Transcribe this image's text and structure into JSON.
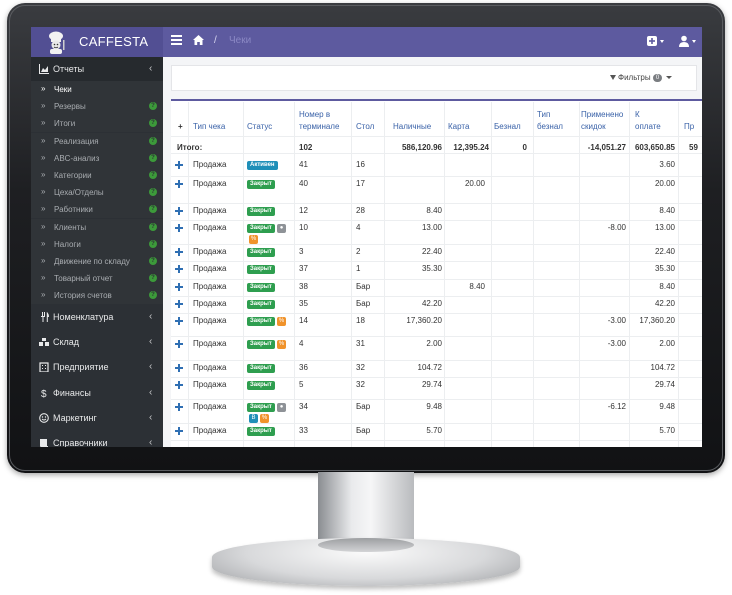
{
  "app": {
    "name": "CAFFESTA"
  },
  "breadcrumb": {
    "separator": "/",
    "current": "Чеки"
  },
  "sidebar": {
    "reports": {
      "label": "Отчеты",
      "chevron": "‹"
    },
    "sub_items": [
      {
        "label": "Чеки",
        "arrow": "»"
      },
      {
        "label": "Резервы",
        "arrow": "»"
      },
      {
        "label": "Итоги",
        "arrow": "»"
      },
      {
        "label": "Реализация",
        "arrow": "»"
      },
      {
        "label": "ABC-анализ",
        "arrow": "»"
      },
      {
        "label": "Категории",
        "arrow": "»"
      },
      {
        "label": "Цеха/Отделы",
        "arrow": "»"
      },
      {
        "label": "Работники",
        "arrow": "»"
      },
      {
        "label": "Клиенты",
        "arrow": "»"
      },
      {
        "label": "Налоги",
        "arrow": "»"
      },
      {
        "label": "Движение по складу",
        "arrow": "»"
      },
      {
        "label": "Товарный отчет",
        "arrow": "»"
      },
      {
        "label": "История счетов",
        "arrow": "»"
      }
    ],
    "help_mark": "?",
    "sections": [
      {
        "label": "Номенклатура",
        "chevron": "‹"
      },
      {
        "label": "Склад",
        "chevron": "‹"
      },
      {
        "label": "Предприятие",
        "chevron": "‹"
      },
      {
        "label": "Финансы",
        "chevron": "‹"
      },
      {
        "label": "Маркетинг",
        "chevron": "‹"
      },
      {
        "label": "Справочники",
        "chevron": "‹"
      }
    ]
  },
  "filters": {
    "label": "Фильтры",
    "count": "0"
  },
  "table": {
    "headers": {
      "plus": "+",
      "type": "Тип чека",
      "status": "Статус",
      "terminal_1": "Номер в",
      "terminal_2": "терминале",
      "table": "Стол",
      "cash": "Наличные",
      "card": "Карта",
      "noncash": "Безнал",
      "noncash_type_1": "Тип",
      "noncash_type_2": "безнал",
      "discount_1": "Применено",
      "discount_2": "скидок",
      "topay_1": "К",
      "topay_2": "оплате",
      "cut": "Пр"
    },
    "totals": {
      "label": "Итого:",
      "terminal": "102",
      "cash": "586,120.96",
      "card": "12,395.24",
      "noncash": "0",
      "discount": "-14,051.27",
      "topay": "603,650.85",
      "cut": "59"
    },
    "rows": [
      {
        "type": "Продажа",
        "status": "Активен",
        "terminal": "41",
        "table": "16",
        "cash": "",
        "card": "",
        "discount": "",
        "topay": "3.60"
      },
      {
        "type": "Продажа",
        "status": "Закрыт",
        "terminal": "40",
        "table": "17",
        "cash": "",
        "card": "20.00",
        "discount": "",
        "topay": "20.00"
      },
      {
        "type": "Продажа",
        "status": "Закрыт",
        "terminal": "12",
        "table": "28",
        "cash": "8.40",
        "card": "",
        "discount": "",
        "topay": "8.40"
      },
      {
        "type": "Продажа",
        "status": "Закрыт",
        "terminal": "10",
        "table": "4",
        "cash": "13.00",
        "card": "",
        "discount": "-8.00",
        "topay": "13.00"
      },
      {
        "type": "Продажа",
        "status": "Закрыт",
        "terminal": "3",
        "table": "2",
        "cash": "22.40",
        "card": "",
        "discount": "",
        "topay": "22.40"
      },
      {
        "type": "Продажа",
        "status": "Закрыт",
        "terminal": "37",
        "table": "1",
        "cash": "35.30",
        "card": "",
        "discount": "",
        "topay": "35.30"
      },
      {
        "type": "Продажа",
        "status": "Закрыт",
        "terminal": "38",
        "table": "Бар",
        "cash": "",
        "card": "8.40",
        "discount": "",
        "topay": "8.40"
      },
      {
        "type": "Продажа",
        "status": "Закрыт",
        "terminal": "35",
        "table": "Бар",
        "cash": "42.20",
        "card": "",
        "discount": "",
        "topay": "42.20"
      },
      {
        "type": "Продажа",
        "status": "Закрыт",
        "terminal": "14",
        "table": "18",
        "cash": "17,360.20",
        "card": "",
        "discount": "-3.00",
        "topay": "17,360.20"
      },
      {
        "type": "Продажа",
        "status": "Закрыт",
        "terminal": "4",
        "table": "31",
        "cash": "2.00",
        "card": "",
        "discount": "-3.00",
        "topay": "2.00"
      },
      {
        "type": "Продажа",
        "status": "Закрыт",
        "terminal": "36",
        "table": "32",
        "cash": "104.72",
        "card": "",
        "discount": "",
        "topay": "104.72"
      },
      {
        "type": "Продажа",
        "status": "Закрыт",
        "terminal": "5",
        "table": "32",
        "cash": "29.74",
        "card": "",
        "discount": "",
        "topay": "29.74"
      },
      {
        "type": "Продажа",
        "status": "Закрыт",
        "terminal": "34",
        "table": "Бар",
        "cash": "9.48",
        "card": "",
        "discount": "-6.12",
        "topay": "9.48"
      },
      {
        "type": "Продажа",
        "status": "Закрыт",
        "terminal": "33",
        "table": "Бар",
        "cash": "5.70",
        "card": "",
        "discount": "",
        "topay": "5.70"
      }
    ],
    "badge_percent": "%",
    "badge_b": "B"
  },
  "colors": {
    "topbar": "#5d5a9f",
    "sidebar": "#2c3035",
    "closed": "#2e9e4f",
    "active": "#1f8fb8",
    "link": "#3a62a8"
  }
}
